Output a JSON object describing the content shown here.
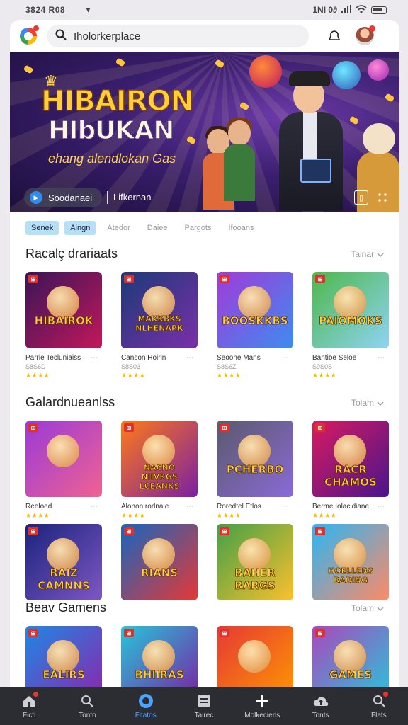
{
  "statusbar": {
    "time": "3824 R08",
    "right_text": "1NI 0∂"
  },
  "header": {
    "search_value": "Iholorkerplace"
  },
  "banner": {
    "title_line1": "HIBAIRON",
    "title_line2": "HIbUKAN",
    "subtitle": "ehang alendlokan Gas",
    "cta_label": "Soodanaei",
    "link_label": "Lifkernan"
  },
  "chips": [
    "Senek",
    "Aingn",
    "Atedor",
    "Daiee",
    "Pargots",
    "Ifooans"
  ],
  "sections": [
    {
      "title": "Racalç drariaats",
      "more_label": "Tainar",
      "rows": [
        [
          {
            "tile_text": "HIBAIROK",
            "name": "Parrie Tecluniaiss",
            "sub": "S8S6D",
            "stars": "★★★★",
            "palette": [
              "#3a1458",
              "#c2185b"
            ]
          },
          {
            "tile_text": "MAKKBKS NLHENARK",
            "name": "Canson Hoirin",
            "sub": "S8S03",
            "stars": "★★★★",
            "palette": [
              "#1c3a78",
              "#7b2fa8"
            ]
          },
          {
            "tile_text": "BOOSKKBS",
            "name": "Seoone Mans",
            "sub": "S8S6Z",
            "stars": "★★★★",
            "palette": [
              "#a23ad8",
              "#3d8cf0"
            ]
          },
          {
            "tile_text": "PAIOMOKS",
            "name": "Bantibe Seloe",
            "sub": "S9S0S",
            "stars": "★★★★",
            "palette": [
              "#4db84a",
              "#8fd3f5"
            ]
          }
        ]
      ]
    },
    {
      "title": "Galardnueanlss",
      "more_label": "Tolam",
      "rows": [
        [
          {
            "tile_text": "",
            "name": "Reeloed",
            "sub": "",
            "stars": "★★★★",
            "palette": [
              "#9a3ad8",
              "#f06292"
            ]
          },
          {
            "tile_text": "NACNO NIIVRGS LCEANKS",
            "name": "Alonon rorlnaie",
            "sub": "",
            "stars": "★★★★",
            "palette": [
              "#ff7a18",
              "#7b1fa2"
            ]
          },
          {
            "tile_text": "PCHERBO",
            "name": "Roredtel Etlos",
            "sub": "",
            "stars": "★★★★",
            "palette": [
              "#5a5a6a",
              "#8a6ad8"
            ]
          },
          {
            "tile_text": "RACR CHAMOS",
            "name": "Berme Iolacidiane",
            "sub": "",
            "stars": "★★★★",
            "palette": [
              "#d81b60",
              "#4a148c"
            ]
          }
        ],
        [
          {
            "tile_text": "RAIZ CAMNNS",
            "palette": [
              "#1a237e",
              "#7e57c2"
            ]
          },
          {
            "tile_text": "RIANS",
            "palette": [
              "#1565c0",
              "#e53935"
            ]
          },
          {
            "tile_text": "BAHER BARGS",
            "palette": [
              "#43a047",
              "#fbc02d"
            ]
          },
          {
            "tile_text": "HOELLERS BADING",
            "palette": [
              "#29b6f6",
              "#ff8a65"
            ]
          }
        ]
      ]
    },
    {
      "title": "Beav Gamens",
      "more_label": "Tolam",
      "rows": [
        [
          {
            "tile_text": "EALIRS",
            "palette": [
              "#1e88e5",
              "#8e24aa"
            ]
          },
          {
            "tile_text": "BHIIRAS",
            "palette": [
              "#26c6da",
              "#7b1fa2"
            ]
          },
          {
            "tile_text": "",
            "palette": [
              "#e53935",
              "#ff9800"
            ]
          },
          {
            "tile_text": "GAMES",
            "palette": [
              "#ab47bc",
              "#26c6da"
            ]
          }
        ]
      ]
    }
  ],
  "nav": [
    {
      "label": "Ficti",
      "icon": "home-icon"
    },
    {
      "label": "Tonto",
      "icon": "search-icon"
    },
    {
      "label": "Fitatos",
      "icon": "chat-icon",
      "active": true
    },
    {
      "label": "Tairec",
      "icon": "document-icon"
    },
    {
      "label": "Molkeciens",
      "icon": "plus-icon"
    },
    {
      "label": "Tonts",
      "icon": "cloud-upload-icon"
    },
    {
      "label": "Flats",
      "icon": "search-icon"
    }
  ],
  "colors": {
    "active_nav": "#4ba4ff",
    "chip_active": "#b6e0f5",
    "badge": "#e0302c",
    "star": "#f4b400"
  }
}
